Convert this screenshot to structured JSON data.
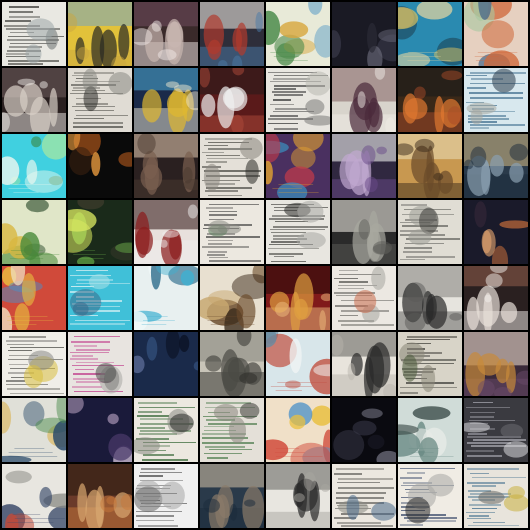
{
  "grid": {
    "rows": 8,
    "cols": 8,
    "background": "#000000",
    "tiles": [
      {
        "palette": [
          "#e9e8e2",
          "#3a3a36",
          "#9da6a8",
          "#6a7070"
        ],
        "style": "document"
      },
      {
        "palette": [
          "#e2c23a",
          "#2a2a24",
          "#7fa6b8",
          "#c9a640"
        ],
        "style": "scene-light"
      },
      {
        "palette": [
          "#3a2a2a",
          "#c9b6b0",
          "#6a4a5a",
          "#f0e8e6"
        ],
        "style": "scene-dark"
      },
      {
        "palette": [
          "#2e2e3a",
          "#b03a2e",
          "#e8e2da",
          "#4a7aa8"
        ],
        "style": "scene-dark"
      },
      {
        "palette": [
          "#e8ead8",
          "#4a8a4a",
          "#d8a840",
          "#6aa6c8"
        ],
        "style": "blob-light"
      },
      {
        "palette": [
          "#1a1a24",
          "#3a3a4a",
          "#6a6a7a",
          "#2a2a36"
        ],
        "style": "dark"
      },
      {
        "palette": [
          "#2a8ab0",
          "#e8d8a0",
          "#1a3a4a",
          "#d8c060"
        ],
        "style": "blob-color"
      },
      {
        "palette": [
          "#e6d0c0",
          "#d0683a",
          "#a8c8a0",
          "#4a6a8a"
        ],
        "style": "blob-light"
      },
      {
        "palette": [
          "#2a2020",
          "#d8d0c8",
          "#6a5a5a",
          "#f0ece8"
        ],
        "style": "scene-dark"
      },
      {
        "palette": [
          "#e0dcd4",
          "#4a4a44",
          "#8a8a84",
          "#2a2a26"
        ],
        "style": "document"
      },
      {
        "palette": [
          "#1a2a4a",
          "#e0b830",
          "#48a0c8",
          "#f0e8d0"
        ],
        "style": "scene-light"
      },
      {
        "palette": [
          "#5a1a1a",
          "#f0f0f0",
          "#2a1a1a",
          "#b04a3a"
        ],
        "style": "scene-dark"
      },
      {
        "palette": [
          "#e8e6e0",
          "#3a3a3a",
          "#7a7a78",
          "#b8b8b0"
        ],
        "style": "document"
      },
      {
        "palette": [
          "#d8d4cc",
          "#4a2a3a",
          "#8a6a6a",
          "#f0ece6"
        ],
        "style": "scene-light"
      },
      {
        "palette": [
          "#3a2818",
          "#e07830",
          "#1a1a1a",
          "#a84a28"
        ],
        "style": "scene-dark"
      },
      {
        "palette": [
          "#d8e8ee",
          "#3a6a8a",
          "#a8a8a0",
          "#2a3a4a"
        ],
        "style": "document"
      },
      {
        "palette": [
          "#40d0e0",
          "#f0f8f0",
          "#3a8a4a",
          "#a8e8a0"
        ],
        "style": "blob-color"
      },
      {
        "palette": [
          "#0a0a0a",
          "#d86a20",
          "#f0a040",
          "#3a2010"
        ],
        "style": "dark"
      },
      {
        "palette": [
          "#2a2020",
          "#7a6050",
          "#d8c0a8",
          "#4a3a30"
        ],
        "style": "scene-dark"
      },
      {
        "palette": [
          "#e4e0d8",
          "#4a4a44",
          "#8a8680",
          "#2a2a26"
        ],
        "style": "document"
      },
      {
        "palette": [
          "#4a3060",
          "#e0a030",
          "#3a90c0",
          "#c03a4a"
        ],
        "style": "blob-color"
      },
      {
        "palette": [
          "#302840",
          "#c0a8d0",
          "#f0f0f0",
          "#6a4a8a"
        ],
        "style": "scene-dark"
      },
      {
        "palette": [
          "#c89850",
          "#6a4a2a",
          "#e8d8b0",
          "#3a2a1a"
        ],
        "style": "scene-light"
      },
      {
        "palette": [
          "#2a3a4a",
          "#8aa0b0",
          "#c8b080",
          "#1a2a3a"
        ],
        "style": "scene-dark"
      },
      {
        "palette": [
          "#e0e6c8",
          "#4a8a3a",
          "#d8b840",
          "#2a4a2a"
        ],
        "style": "blob-light"
      },
      {
        "palette": [
          "#1a2a1a",
          "#6ab04a",
          "#d8e860",
          "#3a3a2a"
        ],
        "style": "blob-color"
      },
      {
        "palette": [
          "#e8e0dc",
          "#8a1a1a",
          "#3a2020",
          "#f0f0f0"
        ],
        "style": "scene-light"
      },
      {
        "palette": [
          "#ece8e0",
          "#3a3a3a",
          "#8a8a84",
          "#5a7a5a"
        ],
        "style": "document"
      },
      {
        "palette": [
          "#e8e6e0",
          "#4a4a46",
          "#a8a8a4",
          "#2a2a28"
        ],
        "style": "document"
      },
      {
        "palette": [
          "#2a2a2a",
          "#a8a8a0",
          "#e8e4dc",
          "#5a5a56"
        ],
        "style": "scene-dark"
      },
      {
        "palette": [
          "#e0ddd4",
          "#5a5a56",
          "#9a9a94",
          "#3a3a36"
        ],
        "style": "document"
      },
      {
        "palette": [
          "#1a1a2a",
          "#c06a3a",
          "#e8a870",
          "#3a2a3a"
        ],
        "style": "dark"
      },
      {
        "palette": [
          "#d04a3a",
          "#e8c040",
          "#4a90c8",
          "#f0e0c0"
        ],
        "style": "blob-color"
      },
      {
        "palette": [
          "#40c0d8",
          "#f0f8f8",
          "#3a6a8a",
          "#a8e0e8"
        ],
        "style": "document"
      },
      {
        "palette": [
          "#e8f0f0",
          "#40b0d0",
          "#f0f8f8",
          "#2a6a8a"
        ],
        "style": "blob-light"
      },
      {
        "palette": [
          "#e8e0d0",
          "#6a4a2a",
          "#c8a870",
          "#3a2a1a"
        ],
        "style": "blob-light"
      },
      {
        "palette": [
          "#801a1a",
          "#e0a040",
          "#2a0a0a",
          "#f0c080"
        ],
        "style": "scene-dark"
      },
      {
        "palette": [
          "#ece8e2",
          "#4a4a46",
          "#a8a6a0",
          "#c86a4a"
        ],
        "style": "document"
      },
      {
        "palette": [
          "#e6e4de",
          "#2a2a2a",
          "#8a8884",
          "#5a5a58"
        ],
        "style": "scene-light"
      },
      {
        "palette": [
          "#2a2020",
          "#e8e0d8",
          "#8a5a4a",
          "#f4f0ec"
        ],
        "style": "scene-light"
      },
      {
        "palette": [
          "#f0eee8",
          "#4a4a46",
          "#d8c040",
          "#8a8a86"
        ],
        "style": "document"
      },
      {
        "palette": [
          "#e8e4e0",
          "#c03a8a",
          "#4a4a4a",
          "#a8a8a4"
        ],
        "style": "document"
      },
      {
        "palette": [
          "#1a2a4a",
          "#3a5a8a",
          "#0a1020",
          "#6a7aa8"
        ],
        "style": "dark"
      },
      {
        "palette": [
          "#c8c4b8",
          "#4a4a44",
          "#8a8a80",
          "#2a2a26"
        ],
        "style": "scene-light"
      },
      {
        "palette": [
          "#d8e6ea",
          "#c04a3a",
          "#6a8aa0",
          "#f0f4f4"
        ],
        "style": "blob-light"
      },
      {
        "palette": [
          "#e8e4dc",
          "#2a2a2a",
          "#6a6a66",
          "#b8b4ac"
        ],
        "style": "scene-light"
      },
      {
        "palette": [
          "#d8d4c8",
          "#2a2a26",
          "#8a8678",
          "#4a5a3a"
        ],
        "style": "document"
      },
      {
        "palette": [
          "#3a2a3a",
          "#c88a3a",
          "#e8d8c8",
          "#6a4a6a"
        ],
        "style": "scene-dark"
      },
      {
        "palette": [
          "#e0e0d8",
          "#2a4a6a",
          "#d8a830",
          "#4a8a4a"
        ],
        "style": "blob-light"
      },
      {
        "palette": [
          "#1a1a3a",
          "#c0a8c8",
          "#4a3a6a",
          "#e8d8e8"
        ],
        "style": "dark"
      },
      {
        "palette": [
          "#ece8e0",
          "#3a6a3a",
          "#8a8a84",
          "#2a2a28"
        ],
        "style": "document"
      },
      {
        "palette": [
          "#e4e0d8",
          "#4a7a4a",
          "#8a8680",
          "#3a3a36"
        ],
        "style": "document"
      },
      {
        "palette": [
          "#f0e0c8",
          "#d04a3a",
          "#e8c040",
          "#4a90c8"
        ],
        "style": "blob-color"
      },
      {
        "palette": [
          "#0a0a10",
          "#3a3a4a",
          "#8a8a9a",
          "#1a1a26"
        ],
        "style": "dark"
      },
      {
        "palette": [
          "#d0dcd8",
          "#6a8a84",
          "#e8ece8",
          "#3a4a48"
        ],
        "style": "blob-light"
      },
      {
        "palette": [
          "#3a3a40",
          "#a8a8b0",
          "#d8d8dc",
          "#6a6a70"
        ],
        "style": "document"
      },
      {
        "palette": [
          "#e8e6e0",
          "#3a4a6a",
          "#c04a3a",
          "#8a8a84"
        ],
        "style": "blob-light"
      },
      {
        "palette": [
          "#6a3a2a",
          "#d8a870",
          "#2a1a10",
          "#c8783a"
        ],
        "style": "scene-dark"
      },
      {
        "palette": [
          "#f0f0f0",
          "#3a3a3a",
          "#a8a8a8",
          "#6a6a6a"
        ],
        "style": "document"
      },
      {
        "palette": [
          "#2a3a4a",
          "#8a7a6a",
          "#c8b8a0",
          "#1a2a3a"
        ],
        "style": "scene-dark"
      },
      {
        "palette": [
          "#e8e6e0",
          "#2a2a2a",
          "#6a6a66",
          "#a8a6a0"
        ],
        "style": "scene-light"
      },
      {
        "palette": [
          "#ece8e0",
          "#3a3a36",
          "#4a6a8a",
          "#8a8a84"
        ],
        "style": "document"
      },
      {
        "palette": [
          "#f0ece4",
          "#3a4a6a",
          "#a8a8a4",
          "#2a2a2a"
        ],
        "style": "document"
      },
      {
        "palette": [
          "#e8e4dc",
          "#3a6a8a",
          "#c8b040",
          "#6a6a66"
        ],
        "style": "document"
      }
    ]
  }
}
